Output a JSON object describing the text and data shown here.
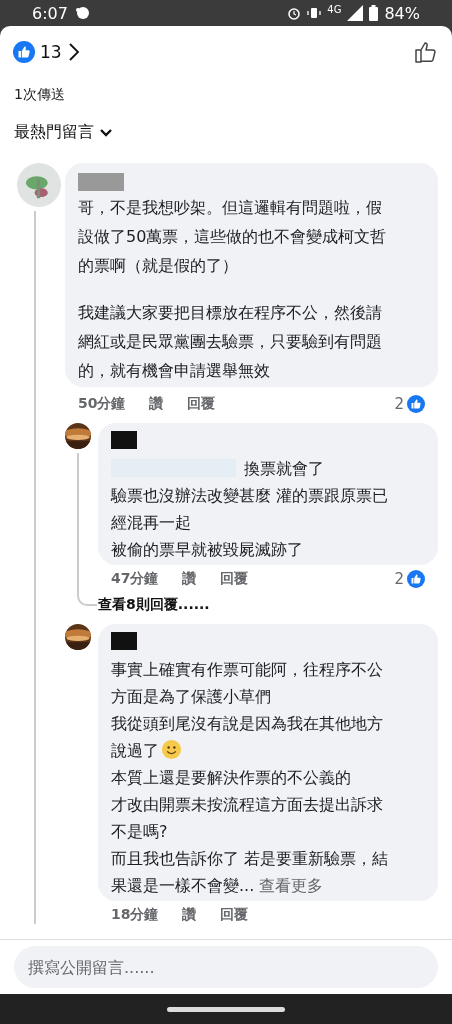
{
  "status_bar": {
    "time": "6:07",
    "network": "4G",
    "battery": "84%"
  },
  "reactions": {
    "count": "13"
  },
  "shares": "1次傳送",
  "sort": {
    "label": "最熱門留言"
  },
  "comments": [
    {
      "body": [
        {
          "kind": "paragraph",
          "text": "哥，不是我想吵架。但這邏輯有問題啦，假設做了50萬票，這些做的也不會變成柯文哲的票啊（就是假的了）"
        },
        {
          "kind": "paragraph",
          "text": "我建議大家要把目標放在程序不公，然後請網紅或是民眾黨團去驗票，只要驗到有問題的，就有機會申請選舉無效"
        }
      ],
      "time": "50分鐘",
      "like": "讚",
      "reply": "回覆",
      "reaction_count": "2",
      "children": [
        {
          "body": [
            {
              "kind": "redacted-line",
              "text": "換票就會了"
            },
            {
              "kind": "line",
              "text": "驗票也沒辦法改變甚麼 灌的票跟原票已經混再一起"
            },
            {
              "kind": "line",
              "text": "被偷的票早就被毀屍滅跡了"
            }
          ],
          "time": "47分鐘",
          "like": "讚",
          "reply": "回覆",
          "reaction_count": "2",
          "more_replies": "查看8則回覆......"
        },
        {
          "body": [
            {
              "kind": "line",
              "text": "事實上確實有作票可能阿，往程序不公方面是為了保護小草們"
            },
            {
              "kind": "emoji-line",
              "text": "我從頭到尾沒有說是因為我在其他地方說過了"
            },
            {
              "kind": "line",
              "text": "本質上還是要解決作票的不公義的"
            },
            {
              "kind": "line",
              "text": "才改由開票未按流程這方面去提出訴求不是嗎?"
            },
            {
              "kind": "link-line",
              "text": "而且我也告訴你了 若是要重新驗票，結果還是一樣不會變...",
              "link": "查看更多"
            }
          ],
          "time": "18分鐘",
          "like": "讚",
          "reply": "回覆"
        }
      ]
    }
  ],
  "composer": {
    "placeholder": "撰寫公開留言......"
  }
}
